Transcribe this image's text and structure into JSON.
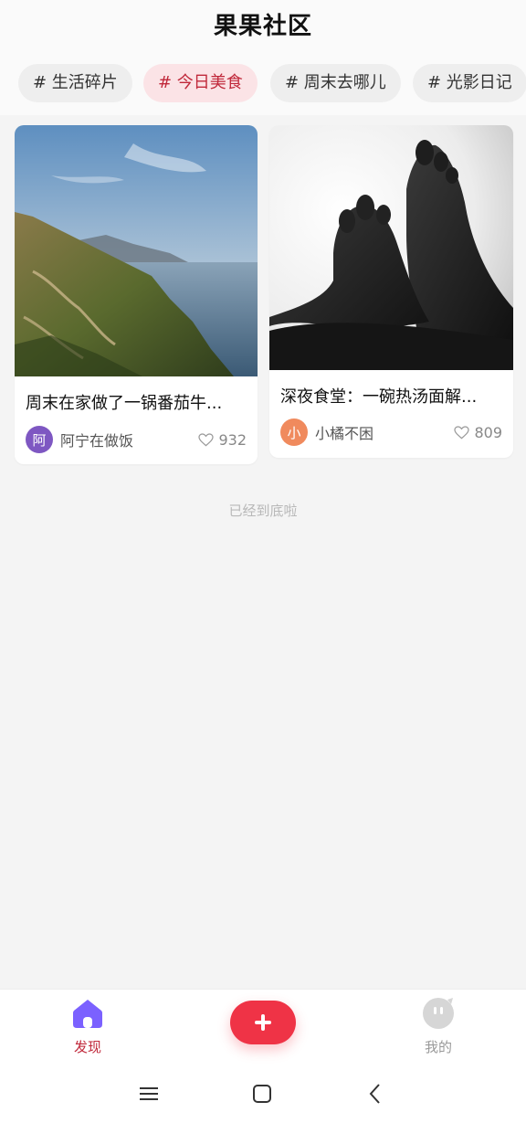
{
  "app": {
    "title": "果果社区"
  },
  "chips": [
    {
      "label": "# 生活碎片",
      "active": false
    },
    {
      "label": "# 今日美食",
      "active": true
    },
    {
      "label": "# 周末去哪儿",
      "active": false
    },
    {
      "label": "# 光影日记",
      "active": false
    }
  ],
  "posts": [
    {
      "title": "周末在家做了一锅番茄牛...",
      "author": "阿宁在做饭",
      "avatar_text": "阿",
      "avatar_color": "#7e57c2",
      "likes": "932",
      "image": "coastal-landscape"
    },
    {
      "title": "深夜食堂：一碗热汤面解...",
      "author": "小橘不困",
      "avatar_text": "小",
      "avatar_color": "#f08a5d",
      "likes": "809",
      "image": "feet-silhouette"
    }
  ],
  "feed": {
    "end_text": "已经到底啦"
  },
  "nav": {
    "home_label": "发现",
    "mine_label": "我的",
    "add_icon": "plus-icon"
  },
  "colors": {
    "accent": "#ef3346",
    "accent_text": "#c0283a",
    "home_icon": "#7b61ff"
  },
  "system_bar": {
    "icons": [
      "menu-icon",
      "home-square-icon",
      "back-icon"
    ]
  }
}
